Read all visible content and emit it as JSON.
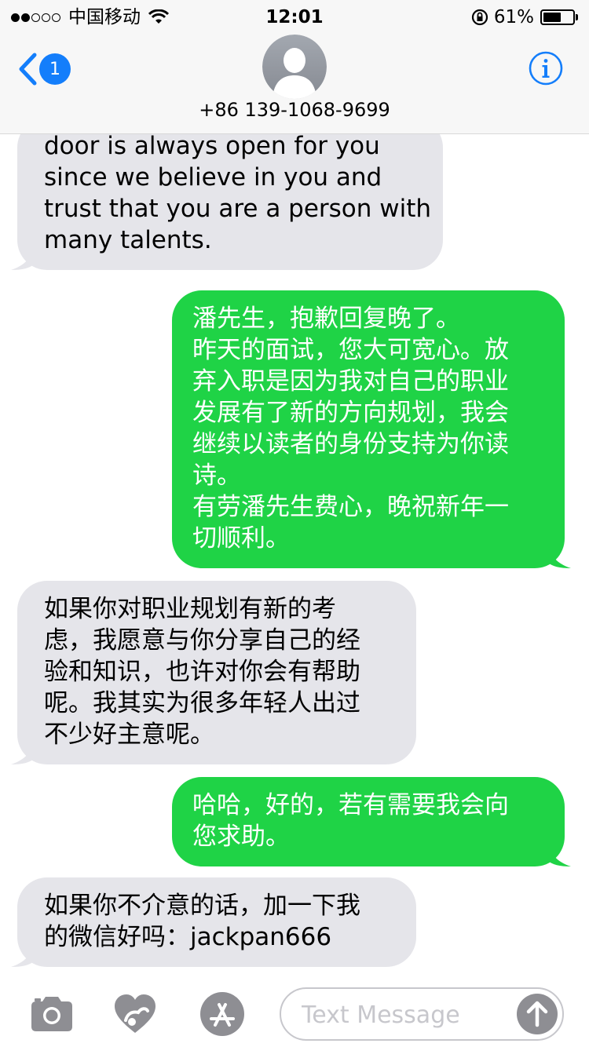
{
  "status_bar": {
    "carrier": "中国移动",
    "time": "12:01",
    "battery_percent": "61%",
    "battery_level": 0.61
  },
  "header": {
    "back_badge": "1",
    "contact_number": "+86 139-1068-9699",
    "back_icon": "chevron-left-icon",
    "info_icon": "info-icon",
    "accent_color": "#147efb"
  },
  "messages": [
    {
      "direction": "received",
      "lines": [
        "door is always open for you",
        "since we believe in you and",
        "trust that you are a person with",
        "many talents."
      ]
    },
    {
      "direction": "sent",
      "lines": [
        "潘先生，抱歉回复晚了。",
        "昨天的面试，您大可宽心。放",
        "弃入职是因为我对自己的职业",
        "发展有了新的方向规划，我会",
        "继续以读者的身份支持为你读",
        "诗。",
        "有劳潘先生费心，晚祝新年一",
        "切顺利。"
      ]
    },
    {
      "direction": "received",
      "lines": [
        "如果你对职业规划有新的考",
        "虑，我愿意与你分享自己的经",
        "验和知识，也许对你会有帮助",
        "呢。我其实为很多年轻人出过",
        "不少好主意呢。"
      ]
    },
    {
      "direction": "sent",
      "lines": [
        "哈哈，好的，若有需要我会向",
        "您求助。"
      ]
    },
    {
      "direction": "received",
      "lines": [
        "如果你不介意的话，加一下我",
        "的微信好吗：jackpan666"
      ]
    }
  ],
  "colors": {
    "received_bubble": "#e5e5ea",
    "sent_bubble": "#1fd346",
    "placeholder": "#c7c7cc"
  },
  "input_bar": {
    "placeholder": "Text Message",
    "icons": [
      "camera-icon",
      "digital-touch-icon",
      "app-store-icon",
      "send-arrow-icon"
    ]
  }
}
